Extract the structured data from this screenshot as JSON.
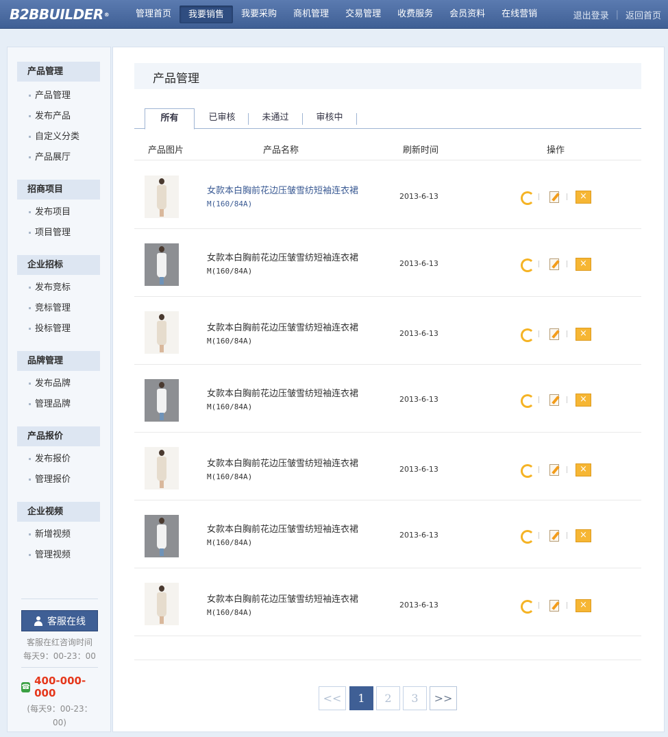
{
  "header": {
    "logo_text": "B2BBUILDER",
    "logo_mark": "®",
    "nav": [
      {
        "label": "管理首页"
      },
      {
        "label": "我要销售"
      },
      {
        "label": "我要采购"
      },
      {
        "label": "商机管理"
      },
      {
        "label": "交易管理"
      },
      {
        "label": "收费服务"
      },
      {
        "label": "会员资料"
      },
      {
        "label": "在线营销"
      }
    ],
    "active_nav": "我要销售",
    "logout": "退出登录",
    "home": "返回首页"
  },
  "sidebar": {
    "groups": [
      {
        "title": "产品管理",
        "items": [
          "产品管理",
          "发布产品",
          "自定义分类",
          "产品展厅"
        ]
      },
      {
        "title": "招商项目",
        "items": [
          "发布项目",
          "项目管理"
        ]
      },
      {
        "title": "企业招标",
        "items": [
          "发布竞标",
          "竞标管理",
          "投标管理"
        ]
      },
      {
        "title": "品牌管理",
        "items": [
          "发布品牌",
          "管理品牌"
        ]
      },
      {
        "title": "产品报价",
        "items": [
          "发布报价",
          "管理报价"
        ]
      },
      {
        "title": "企业视频",
        "items": [
          "新增视频",
          "管理视频"
        ]
      }
    ],
    "service": {
      "button": "客服在线",
      "note": "客服在红咨询时间",
      "hours": "每天9：00-23：00",
      "phone": "400-000-000",
      "phone_hours": "(每天9：00-23：00)"
    }
  },
  "main": {
    "title": "产品管理",
    "tabs": [
      "所有",
      "已审核",
      "未通过",
      "审核中"
    ],
    "active_tab": "所有",
    "columns": [
      "产品图片",
      "产品名称",
      "刷新时间",
      "操作"
    ],
    "rows": [
      {
        "name": "女款本白胸前花边压皱雪纺短袖连衣裙",
        "size": "M(160/84A)",
        "date": "2013-6-13",
        "thumb": "light",
        "highlighted": true
      },
      {
        "name": "女款本白胸前花边压皱雪纺短袖连衣裙",
        "size": "M(160/84A)",
        "date": "2013-6-13",
        "thumb": "dark",
        "highlighted": false
      },
      {
        "name": "女款本白胸前花边压皱雪纺短袖连衣裙",
        "size": "M(160/84A)",
        "date": "2013-6-13",
        "thumb": "light",
        "highlighted": false
      },
      {
        "name": "女款本白胸前花边压皱雪纺短袖连衣裙",
        "size": "M(160/84A)",
        "date": "2013-6-13",
        "thumb": "dark",
        "highlighted": false
      },
      {
        "name": "女款本白胸前花边压皱雪纺短袖连衣裙",
        "size": "M(160/84A)",
        "date": "2013-6-13",
        "thumb": "light",
        "highlighted": false
      },
      {
        "name": "女款本白胸前花边压皱雪纺短袖连衣裙",
        "size": "M(160/84A)",
        "date": "2013-6-13",
        "thumb": "dark",
        "highlighted": false
      },
      {
        "name": "女款本白胸前花边压皱雪纺短袖连衣裙",
        "size": "M(160/84A)",
        "date": "2013-6-13",
        "thumb": "light",
        "highlighted": false
      }
    ],
    "row_icons": [
      "refresh-icon",
      "edit-icon",
      "delete-icon"
    ]
  },
  "pagination": {
    "prev": "<<",
    "pages": [
      "1",
      "2",
      "3"
    ],
    "current": "1",
    "next": ">>"
  },
  "colors": {
    "header": "#4a6aa1",
    "accent": "#3f5f95",
    "link": "#3a5a93",
    "phone": "#e5371b",
    "action": "#f6b634"
  }
}
